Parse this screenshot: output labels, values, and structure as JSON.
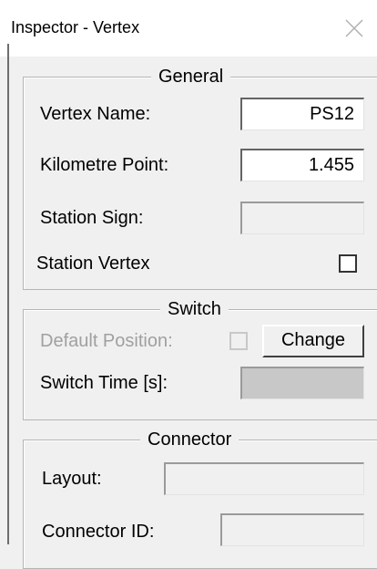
{
  "window": {
    "title": "Inspector - Vertex",
    "close_icon": "close-icon"
  },
  "general": {
    "title": "General",
    "vertex_name_label": "Vertex Name:",
    "vertex_name_value": "PS12",
    "kilometre_point_label": "Kilometre Point:",
    "kilometre_point_value": "1.455",
    "station_sign_label": "Station Sign:",
    "station_sign_value": "",
    "station_vertex_label": "Station Vertex",
    "station_vertex_checked": false
  },
  "switch": {
    "title": "Switch",
    "default_position_label": "Default Position:",
    "default_position_checked": false,
    "change_button_label": "Change",
    "switch_time_label": "Switch Time [s]:",
    "switch_time_value": ""
  },
  "connector": {
    "title": "Connector",
    "layout_label": "Layout:",
    "layout_value": "",
    "connector_id_label": "Connector ID:",
    "connector_id_value": ""
  }
}
